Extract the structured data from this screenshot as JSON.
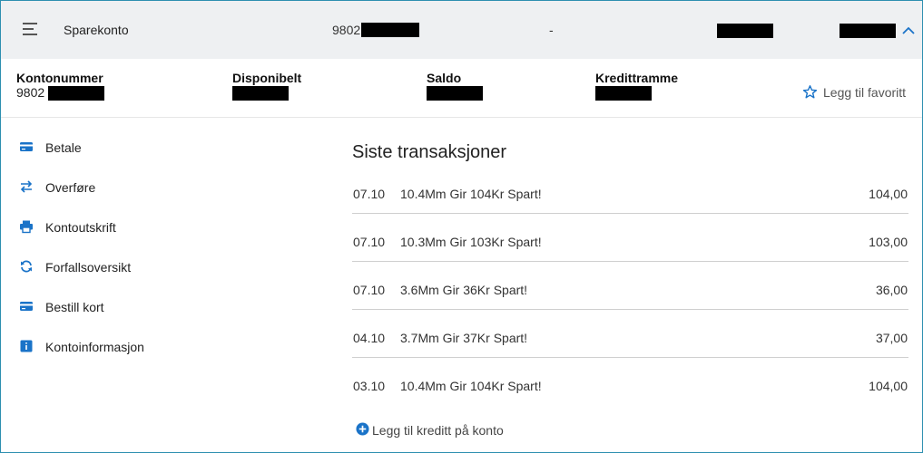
{
  "header": {
    "account_name": "Sparekonto",
    "account_number_prefix": "9802",
    "separator": "-"
  },
  "details": {
    "account_number_label": "Kontonummer",
    "account_number_prefix": "9802",
    "available_label": "Disponibelt",
    "balance_label": "Saldo",
    "credit_limit_label": "Kredittramme",
    "favorite_label": "Legg til favoritt"
  },
  "actions": [
    {
      "label": "Betale",
      "icon": "card-icon"
    },
    {
      "label": "Overføre",
      "icon": "transfer-arrows-icon"
    },
    {
      "label": "Kontoutskrift",
      "icon": "printer-icon"
    },
    {
      "label": "Forfallsoversikt",
      "icon": "refresh-icon"
    },
    {
      "label": "Bestill kort",
      "icon": "card-icon"
    },
    {
      "label": "Kontoinformasjon",
      "icon": "info-icon"
    }
  ],
  "transactions": {
    "title": "Siste transaksjoner",
    "rows": [
      {
        "date": "07.10",
        "description": "10.4Mm Gir 104Kr Spart!",
        "amount": "104,00"
      },
      {
        "date": "07.10",
        "description": "10.3Mm Gir 103Kr Spart!",
        "amount": "103,00"
      },
      {
        "date": "07.10",
        "description": "3.6Mm Gir 36Kr Spart!",
        "amount": "36,00"
      },
      {
        "date": "04.10",
        "description": "3.7Mm Gir 37Kr Spart!",
        "amount": "37,00"
      },
      {
        "date": "03.10",
        "description": "10.4Mm Gir 104Kr Spart!",
        "amount": "104,00"
      }
    ]
  },
  "add_credit_label": "Legg til kreditt på konto",
  "colors": {
    "accent": "#1a73c8",
    "border": "#2d8fb0",
    "header_bg": "#eef0f2"
  }
}
